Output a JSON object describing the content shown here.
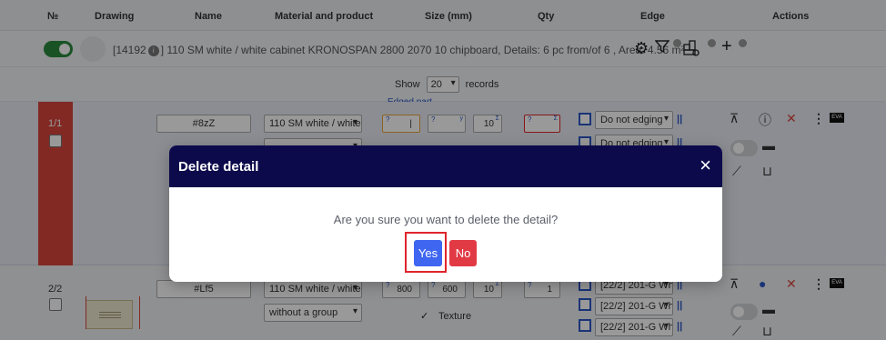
{
  "table_header": {
    "num": "№",
    "drawing": "Drawing",
    "name": "Name",
    "material": "Material and product",
    "size": "Size (mm)",
    "qty": "Qty",
    "edge": "Edge",
    "actions": "Actions"
  },
  "order": {
    "text_before": "[14192",
    "text_after": "] 110 SM white / white cabinet KRONOSPAN 2800 2070 10 chipboard, Details: 6 pc from/of 6 , Area: 4.56 m²",
    "info_icon": "i"
  },
  "paging": {
    "show_label": "Show",
    "records_per_page": "20",
    "records_label": "records"
  },
  "edged_part_label": "Edged part",
  "rows": [
    {
      "num": "1/1",
      "name": "#8zZ",
      "material": "110 SM white / white",
      "size_l_hint": "?",
      "size_w_hint": "?",
      "thickness": "10",
      "qty_hint": "?",
      "qty_sum": "Σ",
      "edge_1": "Do not edging",
      "edge_2": "Do not edging"
    },
    {
      "num": "2/2",
      "name": "#Lf5",
      "material": "110 SM white / white",
      "group": "without a group",
      "length": "800",
      "width": "600",
      "thickness": "10",
      "qty": "1",
      "texture_label": "Texture",
      "edge_1": "[22/2] 201-G Wh",
      "edge_2": "[22/2] 201-G Wh",
      "edge_3": "[22/2] 201-G Wh"
    }
  ],
  "action_labels": {
    "eva": "EVA"
  },
  "modal": {
    "title": "Delete detail",
    "close_glyph": "×",
    "question": "Are you sure you want to delete the detail?",
    "yes_label": "Yes",
    "no_label": "No"
  },
  "colors": {
    "modal_header": "#0c0a4b",
    "yes_button": "#3e66f0",
    "no_button": "#e13a45",
    "focus_ring": "#e0242b",
    "row_marker": "#d9453c"
  }
}
